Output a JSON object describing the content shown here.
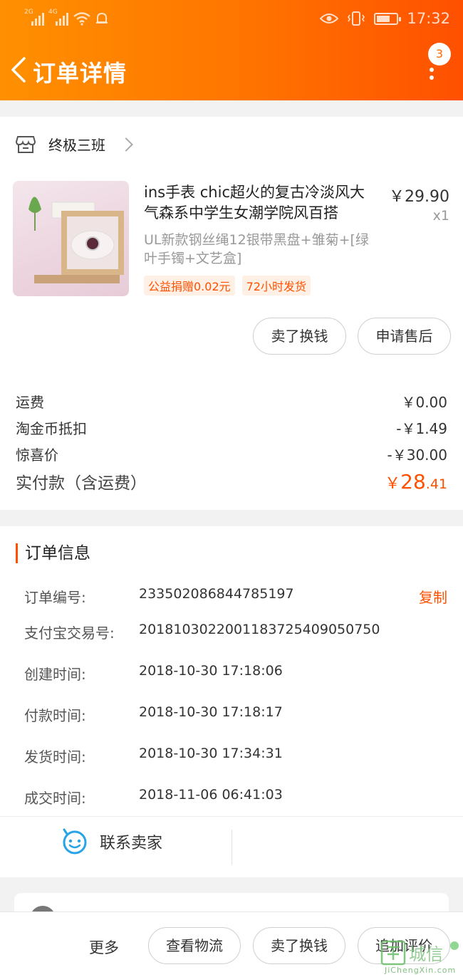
{
  "status_bar": {
    "net1": "2G",
    "net2": "4G",
    "time": "17:32",
    "battery_level": 0.7
  },
  "header": {
    "title": "订单详情",
    "badge_count": "3"
  },
  "shop": {
    "name": "终极三班"
  },
  "product": {
    "title": "ins手表 chic超火的复古冷淡风大气森系中学生女潮学院风百搭",
    "price": "￥29.90",
    "qty": "x1",
    "spec": "UL新款钢丝绳12银带黑盘+雏菊+[绿叶手镯+文艺盒]",
    "tags": [
      "公益捐赠0.02元",
      "72小时发货"
    ]
  },
  "item_actions": {
    "sell_label": "卖了换钱",
    "aftersale_label": "申请售后"
  },
  "fees": [
    {
      "label": "运费",
      "value": "￥0.00"
    },
    {
      "label": "淘金币抵扣",
      "value": "-￥1.49"
    },
    {
      "label": "惊喜价",
      "value": "-￥30.00"
    }
  ],
  "total": {
    "label": "实付款（含运费）",
    "currency": "￥",
    "int": "28",
    "dec": ".41"
  },
  "order_info": {
    "title": "订单信息",
    "copy_label": "复制",
    "rows": [
      {
        "label": "订单编号:",
        "value": "233502086844785197"
      },
      {
        "label": "支付宝交易号:",
        "value": "2018103022001183725409050750"
      },
      {
        "label": "创建时间:",
        "value": "2018-10-30 17:18:06"
      },
      {
        "label": "付款时间:",
        "value": "2018-10-30 17:18:17"
      },
      {
        "label": "发货时间:",
        "value": "2018-10-30 17:34:31"
      },
      {
        "label": "成交时间:",
        "value": "2018-11-06 06:41:03"
      }
    ]
  },
  "contact": {
    "label": "联系卖家"
  },
  "bottom_bar": {
    "more_label": "更多",
    "buttons": [
      "查看物流",
      "卖了换钱",
      "追加评价"
    ]
  },
  "watermark": {
    "text": "城信",
    "sub": "JiChengXin.com"
  },
  "colors": {
    "accent": "#ff5000",
    "header_start": "#ff9000",
    "header_end": "#ff5000",
    "contact_icon": "#29a3e8"
  }
}
